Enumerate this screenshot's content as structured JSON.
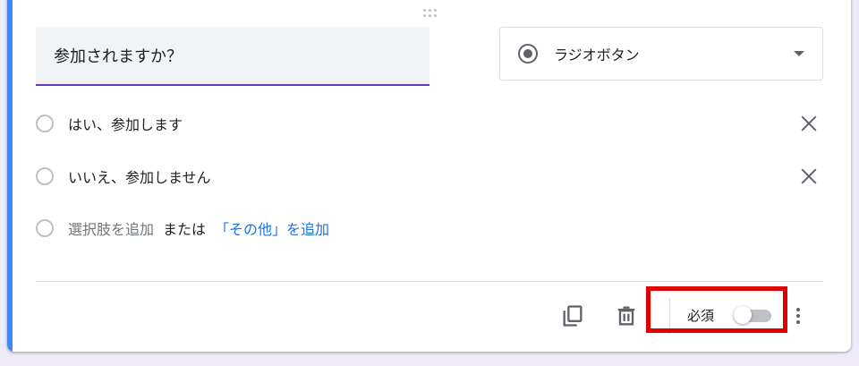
{
  "question": {
    "title": "参加されますか？"
  },
  "question_type": {
    "selected": "ラジオボタン",
    "icon": "radio-checked-icon"
  },
  "options": [
    {
      "label": "はい、参加します"
    },
    {
      "label": "いいえ、参加しません"
    }
  ],
  "add_row": {
    "add_option": "選択肢を追加",
    "or": "または",
    "add_other": "「その他」を追加"
  },
  "footer": {
    "required_label": "必須",
    "required_on": false
  },
  "colors": {
    "accent": "#4285f4",
    "underline": "#673ab7",
    "link": "#1a73e8",
    "highlight_box": "#e00000",
    "background": "#f0ebf8"
  }
}
